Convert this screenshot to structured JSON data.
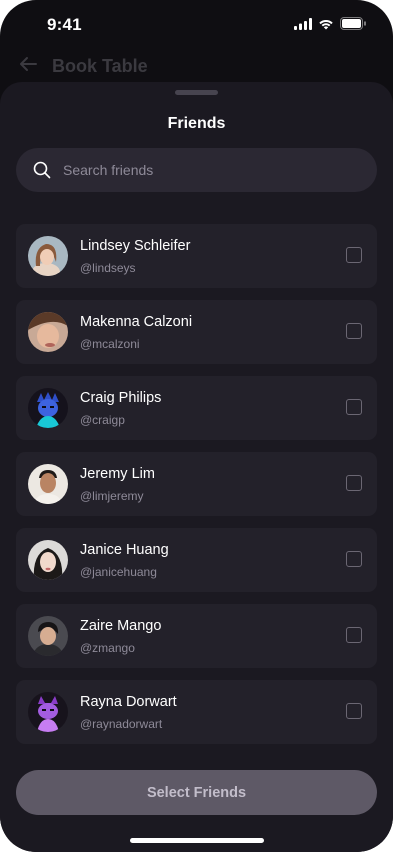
{
  "status_bar": {
    "time": "9:41"
  },
  "background_page": {
    "title": "Book Table"
  },
  "sheet": {
    "title": "Friends",
    "search": {
      "placeholder": "Search friends",
      "value": ""
    },
    "friends": [
      {
        "name": "Lindsey Schleifer",
        "handle": "@lindseys",
        "checked": false
      },
      {
        "name": "Makenna Calzoni",
        "handle": "@mcalzoni",
        "checked": false
      },
      {
        "name": "Craig Philips",
        "handle": "@craigp",
        "checked": false
      },
      {
        "name": "Jeremy Lim",
        "handle": "@limjeremy",
        "checked": false
      },
      {
        "name": "Janice Huang",
        "handle": "@janicehuang",
        "checked": false
      },
      {
        "name": "Zaire Mango",
        "handle": "@zmango",
        "checked": false
      },
      {
        "name": "Rayna Dorwart",
        "handle": "@raynadorwart",
        "checked": false
      }
    ],
    "cta_label": "Select Friends"
  },
  "colors": {
    "background": "#0f0e12",
    "sheet": "#1b1921",
    "row": "#23212a",
    "button_disabled": "#5e5966"
  }
}
